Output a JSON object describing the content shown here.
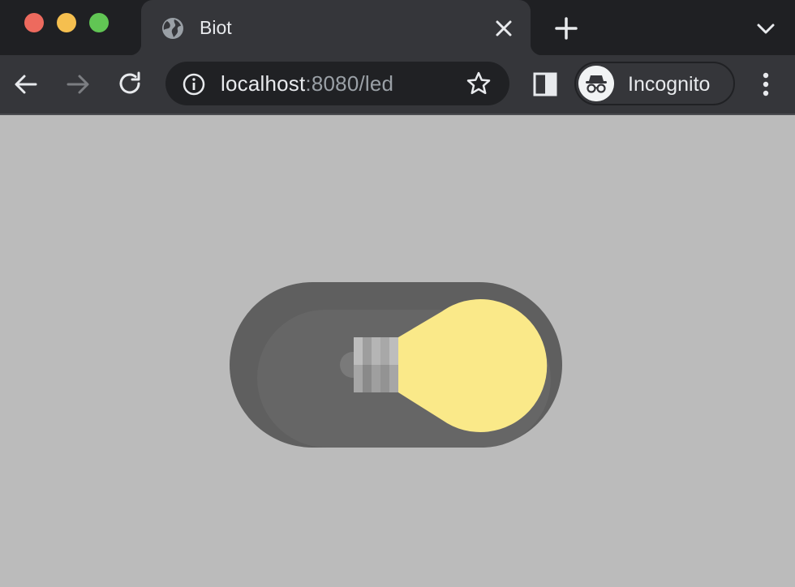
{
  "window": {
    "controls": [
      "close",
      "minimize",
      "zoom"
    ]
  },
  "tab": {
    "title": "Biot",
    "favicon": "globe-icon"
  },
  "toolbar": {
    "url_host": "localhost",
    "url_rest": ":8080/led",
    "profile_label": "Incognito"
  },
  "led": {
    "state": "on",
    "bulb_color": "#fae989",
    "track_color": "#5f5f5f"
  },
  "colors": {
    "page_background": "#bbbbbb",
    "chrome_dark": "#1f2023",
    "chrome_toolbar": "#35363a"
  }
}
